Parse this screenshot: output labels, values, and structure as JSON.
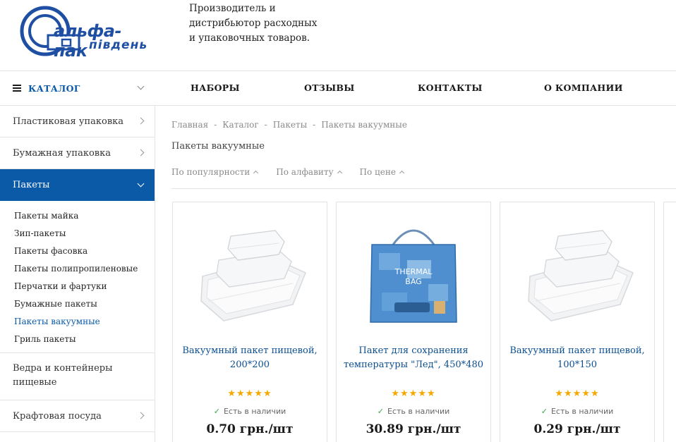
{
  "header": {
    "logo_main": "альфа-пак",
    "logo_sub": "південь",
    "tagline_lines": [
      "Производитель и",
      "дистрибьютор расходных",
      "и упаковочных товаров."
    ]
  },
  "nav": {
    "catalog_label": "КАТАЛОГ",
    "items": [
      "НАБОРЫ",
      "ОТЗЫВЫ",
      "КОНТАКТЫ",
      "О КОМПАНИИ"
    ]
  },
  "sidebar": {
    "categories_top": [
      "Пластиковая упаковка",
      "Бумажная упаковка"
    ],
    "active_category": "Пакеты",
    "subitems": [
      "Пакеты майка",
      "Зип-пакеты",
      "Пакеты фасовка",
      "Пакеты полипропиленовые",
      "Перчатки и фартуки",
      "Бумажные пакеты",
      "Пакеты вакуумные",
      "Гриль пакеты"
    ],
    "current_subitem": "Пакеты вакуумные",
    "categories_bottom": [
      "Ведра и контейнеры пищевые",
      "Крафтовая посуда"
    ]
  },
  "breadcrumb": [
    "Главная",
    "Каталог",
    "Пакеты",
    "Пакеты вакуумные"
  ],
  "breadcrumb_sep": "-",
  "page_title": "Пакеты вакуумные",
  "sort_options": [
    "По популярности",
    "По алфавиту",
    "По цене"
  ],
  "products": [
    {
      "title": "Вакуумный пакет пищевой, 200*200",
      "rating": 5,
      "stock": "Есть в наличии",
      "price": "0.70 грн./шт",
      "image": "vacuum-bags"
    },
    {
      "title": "Пакет для сохранения температуры \"Лед\", 450*480",
      "rating": 5,
      "stock": "Есть в наличии",
      "price": "30.89 грн./шт",
      "image": "thermal-bag",
      "image_text": "THERMAL BAG"
    },
    {
      "title": "Вакуумный пакет пищевой, 100*150",
      "rating": 5,
      "stock": "Есть в наличии",
      "price": "0.29 грн./шт",
      "image": "vacuum-bags"
    }
  ],
  "colors": {
    "accent": "#0b5aa8",
    "link": "#0b4f8f",
    "star": "#f5a800",
    "check": "#3aa33a"
  }
}
